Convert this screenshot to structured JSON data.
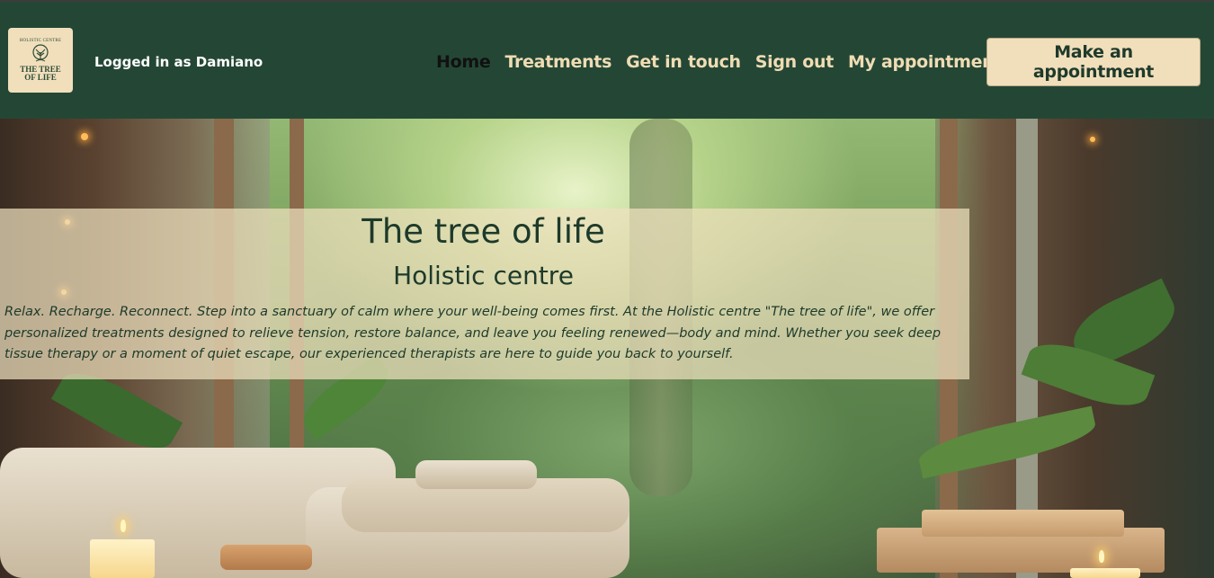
{
  "header": {
    "logo": {
      "arc_text": "HOLISTIC CENTRE",
      "line1": "THE TREE",
      "line2": "OF LIFE"
    },
    "user_status": "Logged in as Damiano",
    "nav": [
      {
        "label": "Home",
        "active": true
      },
      {
        "label": "Treatments",
        "active": false
      },
      {
        "label": "Get in touch",
        "active": false
      },
      {
        "label": "Sign out",
        "active": false
      },
      {
        "label": "My appointments",
        "active": false
      }
    ],
    "cta_label": "Make an appointment"
  },
  "hero": {
    "title": "The tree of life",
    "subtitle": "Holistic centre",
    "intro": "Relax. Recharge. Reconnect. Step into a sanctuary of calm where your well-being comes first. At the Holistic centre \"The tree of life\", we offer personalized treatments designed to relieve tension, restore balance, and leave you feeling renewed—body and mind. Whether you seek deep tissue therapy or a moment of quiet escape, our experienced therapists are here to guide you back to yourself."
  },
  "colors": {
    "header_bg": "#244735",
    "accent_cream": "#f1dfbc",
    "nav_text": "#efdcb4",
    "heading_text": "#1d3a2a"
  }
}
